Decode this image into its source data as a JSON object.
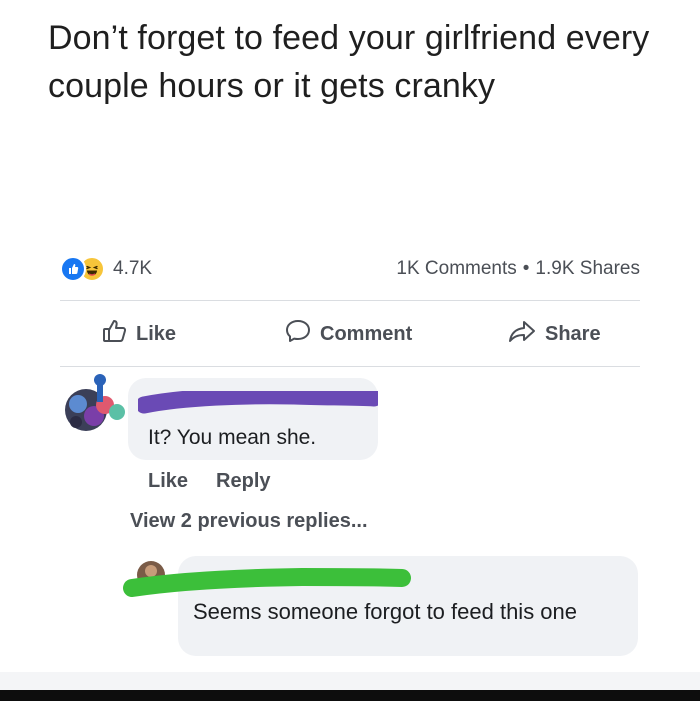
{
  "post": {
    "text": "Don’t forget to feed your girlfriend every couple hours or it gets cranky"
  },
  "stats": {
    "reactions_count": "4.7K",
    "comments": "1K Comments",
    "separator": "•",
    "shares": "1.9K Shares",
    "reaction_icons": [
      "like-icon",
      "haha-icon"
    ]
  },
  "actions": {
    "like": "Like",
    "comment": "Comment",
    "share": "Share"
  },
  "comment1": {
    "text": "It? You mean she.",
    "like": "Like",
    "reply": "Reply",
    "redaction_color": "#6a4ab5"
  },
  "view_previous": "View 2 previous replies...",
  "comment2": {
    "text": "Seems someone forgot to feed this one",
    "redaction_color": "#3cbf3a"
  },
  "colors": {
    "accent": "#1877f2",
    "haha": "#f7c53a",
    "muted_text": "#4b4f56",
    "bubble": "#f0f2f5"
  }
}
